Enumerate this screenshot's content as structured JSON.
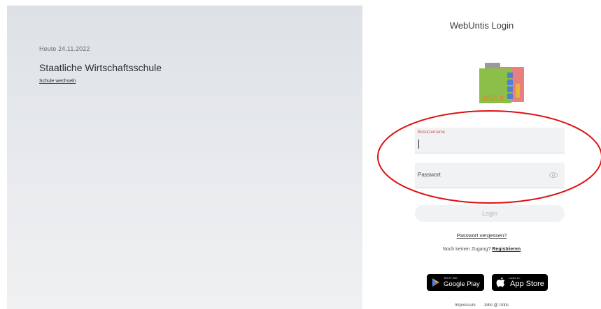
{
  "left": {
    "date_text": "Heute 24.11.2022",
    "school_name": "Staatliche Wirtschaftsschule",
    "change_school_link": "Schule wechseln"
  },
  "login": {
    "title": "WebUntis Login",
    "logo_text": "BSZ II",
    "username_label": "Benutzername",
    "username_value": "",
    "password_placeholder": "Passwort",
    "login_button": "Login",
    "forgot_password": "Passwort vergessen?",
    "no_access_text": "Noch keinen Zugang?",
    "register_link": "Registrieren"
  },
  "stores": {
    "google_small": "JETZT BEI",
    "google_big": "Google Play",
    "apple_small": "Laden im",
    "apple_big": "App Store"
  },
  "footer": {
    "imprint": "Impressum",
    "jobs": "Jobs @ Untis"
  },
  "colors": {
    "accent_red": "#d9534f",
    "annotation_red": "#e01010",
    "button_disabled": "#f1f2f4"
  },
  "icons": [
    "eye-icon",
    "google-play-icon",
    "apple-icon"
  ]
}
